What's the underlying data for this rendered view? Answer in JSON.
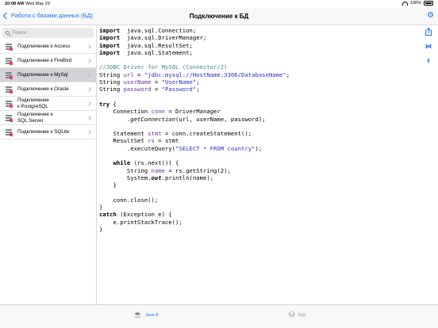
{
  "status_bar": {
    "time": "10:08 AM",
    "date": "Wed May 29",
    "battery": "100%"
  },
  "nav": {
    "back_label": "Работа с базами данных (БД)",
    "title": "Подключение к БД"
  },
  "icons": {
    "settings": "gear-icon",
    "share": "share-icon",
    "collapse": "collapse-icon",
    "sort": "sort-icon",
    "database": "database-icon"
  },
  "sidebar": {
    "search_placeholder": "Поиск",
    "items": [
      {
        "label": "Подключение к Access",
        "selected": false
      },
      {
        "label": "Подключение к FireBird",
        "selected": false
      },
      {
        "label": "Подключение к MySql",
        "selected": true
      },
      {
        "label": "Подключение к Oracle",
        "selected": false
      },
      {
        "label": "Подключение\nк PostgreSQL",
        "selected": false
      },
      {
        "label": "Подключение к\nSQL Server",
        "selected": false
      },
      {
        "label": "Подключение к SQLite",
        "selected": false
      }
    ]
  },
  "code": {
    "lines": [
      [
        [
          "kw",
          "import"
        ],
        [
          "",
          "  java.sql.Connection;"
        ]
      ],
      [
        [
          "kw",
          "import"
        ],
        [
          "",
          "  java.sql.DriverManager;"
        ]
      ],
      [
        [
          "kw",
          "import"
        ],
        [
          "",
          "  java.sql.ResultSet;"
        ]
      ],
      [
        [
          "kw",
          "import"
        ],
        [
          "",
          "  java.sql.Statement;"
        ]
      ],
      [
        [
          "",
          ""
        ]
      ],
      [
        [
          "cm",
          "//JDBC Driver for MySQL (Connector/J)"
        ]
      ],
      [
        [
          "",
          "String "
        ],
        [
          "var",
          "url"
        ],
        [
          "",
          " = "
        ],
        [
          "str",
          "\"jdbc:mysql://HostName:3306/DatabaseName\""
        ],
        [
          "",
          ";"
        ]
      ],
      [
        [
          "",
          "String "
        ],
        [
          "var",
          "userName"
        ],
        [
          "",
          " = "
        ],
        [
          "str",
          "\"UserName\""
        ],
        [
          "",
          ";"
        ]
      ],
      [
        [
          "",
          "String "
        ],
        [
          "var",
          "password"
        ],
        [
          "",
          " = "
        ],
        [
          "str",
          "\"Password\""
        ],
        [
          "",
          ";"
        ]
      ],
      [
        [
          "",
          ""
        ]
      ],
      [
        [
          "kw",
          "try"
        ],
        [
          "",
          " {"
        ]
      ],
      [
        [
          "",
          "    Connection "
        ],
        [
          "var",
          "conn"
        ],
        [
          "",
          " = DriverManager"
        ]
      ],
      [
        [
          "",
          "        ."
        ],
        [
          "it",
          "getConnection"
        ],
        [
          "",
          "(url, userName, password);"
        ]
      ],
      [
        [
          "",
          ""
        ]
      ],
      [
        [
          "",
          "    Statement "
        ],
        [
          "var",
          "stmt"
        ],
        [
          "",
          " = conn.createStatement();"
        ]
      ],
      [
        [
          "",
          "    ResultSet "
        ],
        [
          "var",
          "rs"
        ],
        [
          "",
          " = stmt"
        ]
      ],
      [
        [
          "",
          "        .executeQuery("
        ],
        [
          "str",
          "\"SELECT * FROM country\""
        ],
        [
          "",
          ");"
        ]
      ],
      [
        [
          "",
          ""
        ]
      ],
      [
        [
          "",
          "    "
        ],
        [
          "kw",
          "while"
        ],
        [
          "",
          " (rs.next()) {"
        ]
      ],
      [
        [
          "",
          "        String "
        ],
        [
          "var",
          "name"
        ],
        [
          "",
          " = rs.getString(2);"
        ]
      ],
      [
        [
          "",
          "        System."
        ],
        [
          "bd",
          "out"
        ],
        [
          "",
          ".println(name);"
        ]
      ],
      [
        [
          "",
          "    }"
        ]
      ],
      [
        [
          "",
          ""
        ]
      ],
      [
        [
          "",
          "    conn.close();"
        ]
      ],
      [
        [
          "",
          "}"
        ]
      ],
      [
        [
          "kw",
          "catch"
        ],
        [
          "",
          " (Exception e) {"
        ]
      ],
      [
        [
          "",
          "    e.printStackTrace();"
        ]
      ],
      [
        [
          "",
          "}"
        ]
      ]
    ]
  },
  "tabs": [
    {
      "label": "Java 8",
      "icon": "java-cup-icon",
      "active": true
    },
    {
      "label": "SQL",
      "icon": "database-icon",
      "active": false
    }
  ],
  "colors": {
    "accent": "#1a73e8",
    "comment": "#3c8a8a",
    "string": "#2b2fc4",
    "variable": "#6b2fa8",
    "selected_row": "#d4d4d8"
  }
}
